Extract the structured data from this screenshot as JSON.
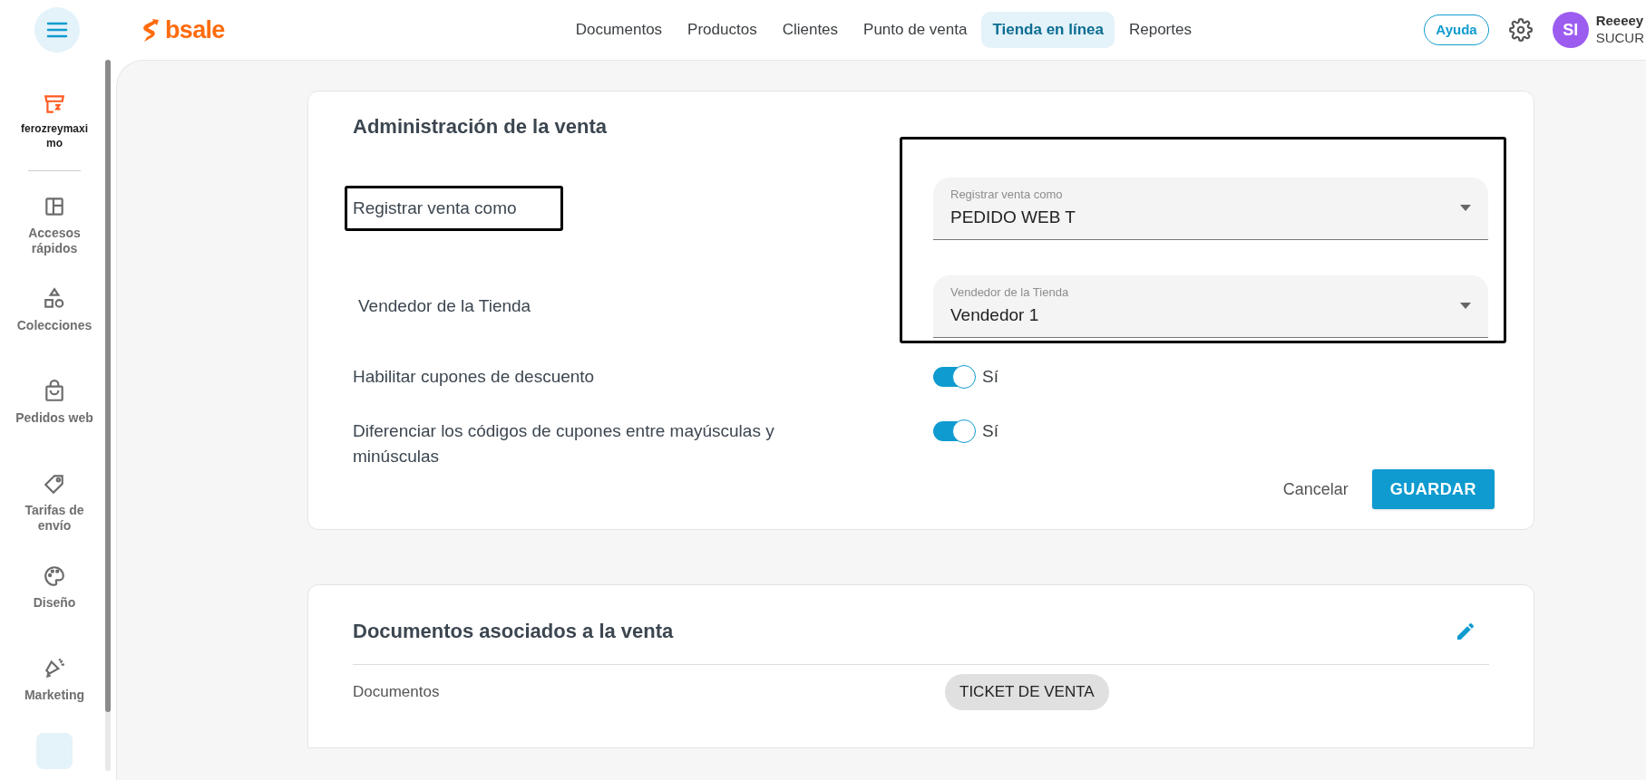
{
  "header": {
    "logo": "bsale",
    "nav": [
      {
        "label": "Documentos",
        "selected": false
      },
      {
        "label": "Productos",
        "selected": false
      },
      {
        "label": "Clientes",
        "selected": false
      },
      {
        "label": "Punto de venta",
        "selected": false
      },
      {
        "label": "Tienda en línea",
        "selected": true
      },
      {
        "label": "Reportes",
        "selected": false
      }
    ],
    "help_button": "Ayuda",
    "user": {
      "initials": "SI",
      "name": "Reeeey",
      "branch": "SUCUR"
    }
  },
  "sidebar": {
    "store_name": "ferozreymaximo",
    "items": [
      {
        "label": "Accesos rápidos"
      },
      {
        "label": "Colecciones"
      },
      {
        "label": "Pedidos web"
      },
      {
        "label": "Tarifas de envío"
      },
      {
        "label": "Diseño"
      },
      {
        "label": "Marketing"
      }
    ]
  },
  "sale_admin": {
    "title": "Administración de la venta",
    "fields": [
      {
        "kind": "select",
        "label": "Registrar venta como",
        "floating_label": "Registrar venta como",
        "value": "PEDIDO WEB T",
        "highlighted": true
      },
      {
        "kind": "select",
        "label": "Vendedor de la Tienda",
        "floating_label": "Vendedor de la Tienda",
        "value": "Vendedor 1",
        "highlighted": false
      },
      {
        "kind": "toggle",
        "label": "Habilitar cupones de descuento",
        "on": true,
        "value_label": "Sí"
      },
      {
        "kind": "toggle",
        "label": "Diferenciar los códigos de cupones entre mayúsculas y minúsculas",
        "on": true,
        "value_label": "Sí"
      }
    ],
    "cancel": "Cancelar",
    "save": "GUARDAR"
  },
  "documents": {
    "title": "Documentos asociados a la venta",
    "rows": [
      {
        "label": "Documentos",
        "chips": [
          "TICKET DE VENTA"
        ]
      }
    ]
  }
}
